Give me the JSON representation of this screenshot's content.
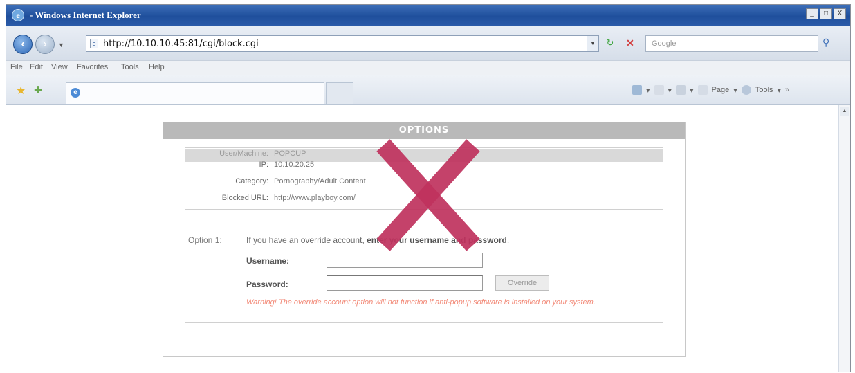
{
  "window": {
    "title": "- Windows Internet Explorer",
    "controls": [
      "_",
      "□",
      "X"
    ]
  },
  "address": {
    "url": "http://10.10.10.45:81/cgi/block.cgi"
  },
  "search": {
    "placeholder": "Google"
  },
  "menu": {
    "items": [
      "File",
      "Edit",
      "View",
      "Favorites",
      "Tools",
      "Help"
    ]
  },
  "command_bar": {
    "page_label": "Page",
    "tools_label": "Tools",
    "more": "»"
  },
  "block_page": {
    "title": "OPTIONS",
    "info": [
      {
        "label": "User/Machine:",
        "value": "POPCUP"
      },
      {
        "label": "IP:",
        "value": "10.10.20.25"
      },
      {
        "label": "Category:",
        "value": "Pornography/Adult Content"
      },
      {
        "label": "Blocked URL:",
        "value": "http://www.playboy.com/"
      }
    ],
    "option1": {
      "label": "Option 1:",
      "text_plain": "If you have an override account, ",
      "text_bold": "enter your username and password",
      "text_end": ".",
      "username_label": "Username:",
      "password_label": "Password:",
      "override_button": "Override",
      "warning": "Warning! The override account option will not function if anti-popup software is installed on your system."
    }
  },
  "overlay": {
    "mark": "X",
    "color": "#c0325e"
  }
}
